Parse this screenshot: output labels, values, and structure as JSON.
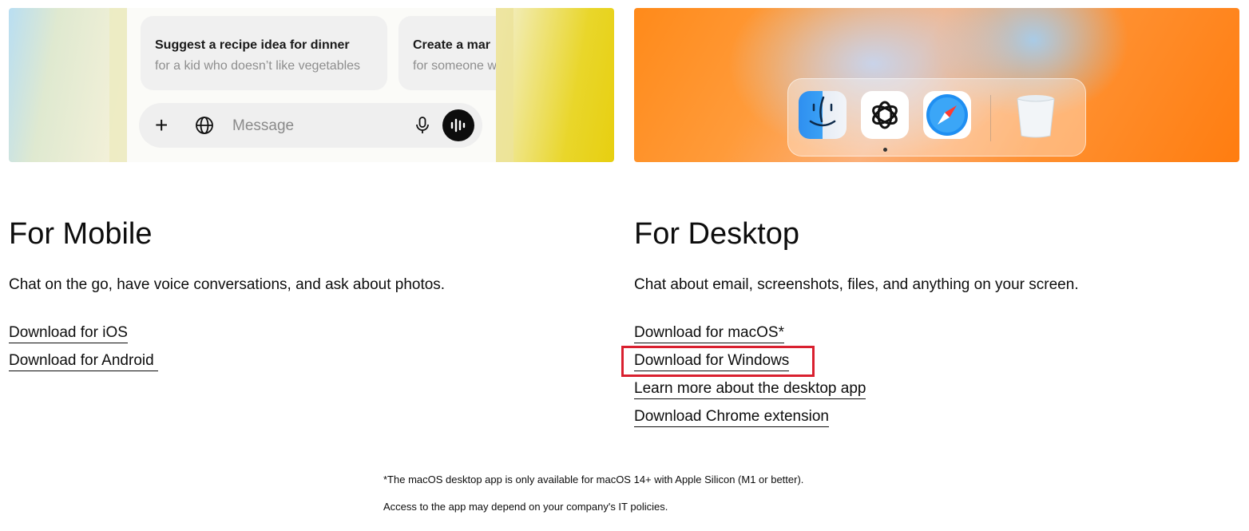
{
  "mobile": {
    "suggestions": [
      {
        "title": "Suggest a recipe idea for dinner",
        "subtitle": "for a kid who doesn’t like vegetables"
      },
      {
        "title": "Create a mar",
        "subtitle": "for someone w"
      }
    ],
    "message_placeholder": "Message",
    "title": "For Mobile",
    "description": "Chat on the go, have voice conversations, and ask about photos.",
    "links": [
      "Download for iOS",
      "Download for Android "
    ]
  },
  "desktop": {
    "title": "For Desktop",
    "description": "Chat about email, screenshots, files, and anything on your screen.",
    "links": [
      "Download for macOS*",
      "Download for Windows",
      "Learn more about the desktop app",
      "Download Chrome extension"
    ],
    "highlighted_link_index": 1,
    "dock_icons": [
      "finder-icon",
      "chatgpt-icon",
      "safari-icon",
      "trash-icon"
    ]
  },
  "footnotes": [
    "*The macOS desktop app is only available for macOS 14+ with Apple Silicon (M1 or better).",
    "Access to the app may depend on your company's IT policies."
  ],
  "colors": {
    "highlight": "#d9202f",
    "text": "#0d0d0d"
  }
}
